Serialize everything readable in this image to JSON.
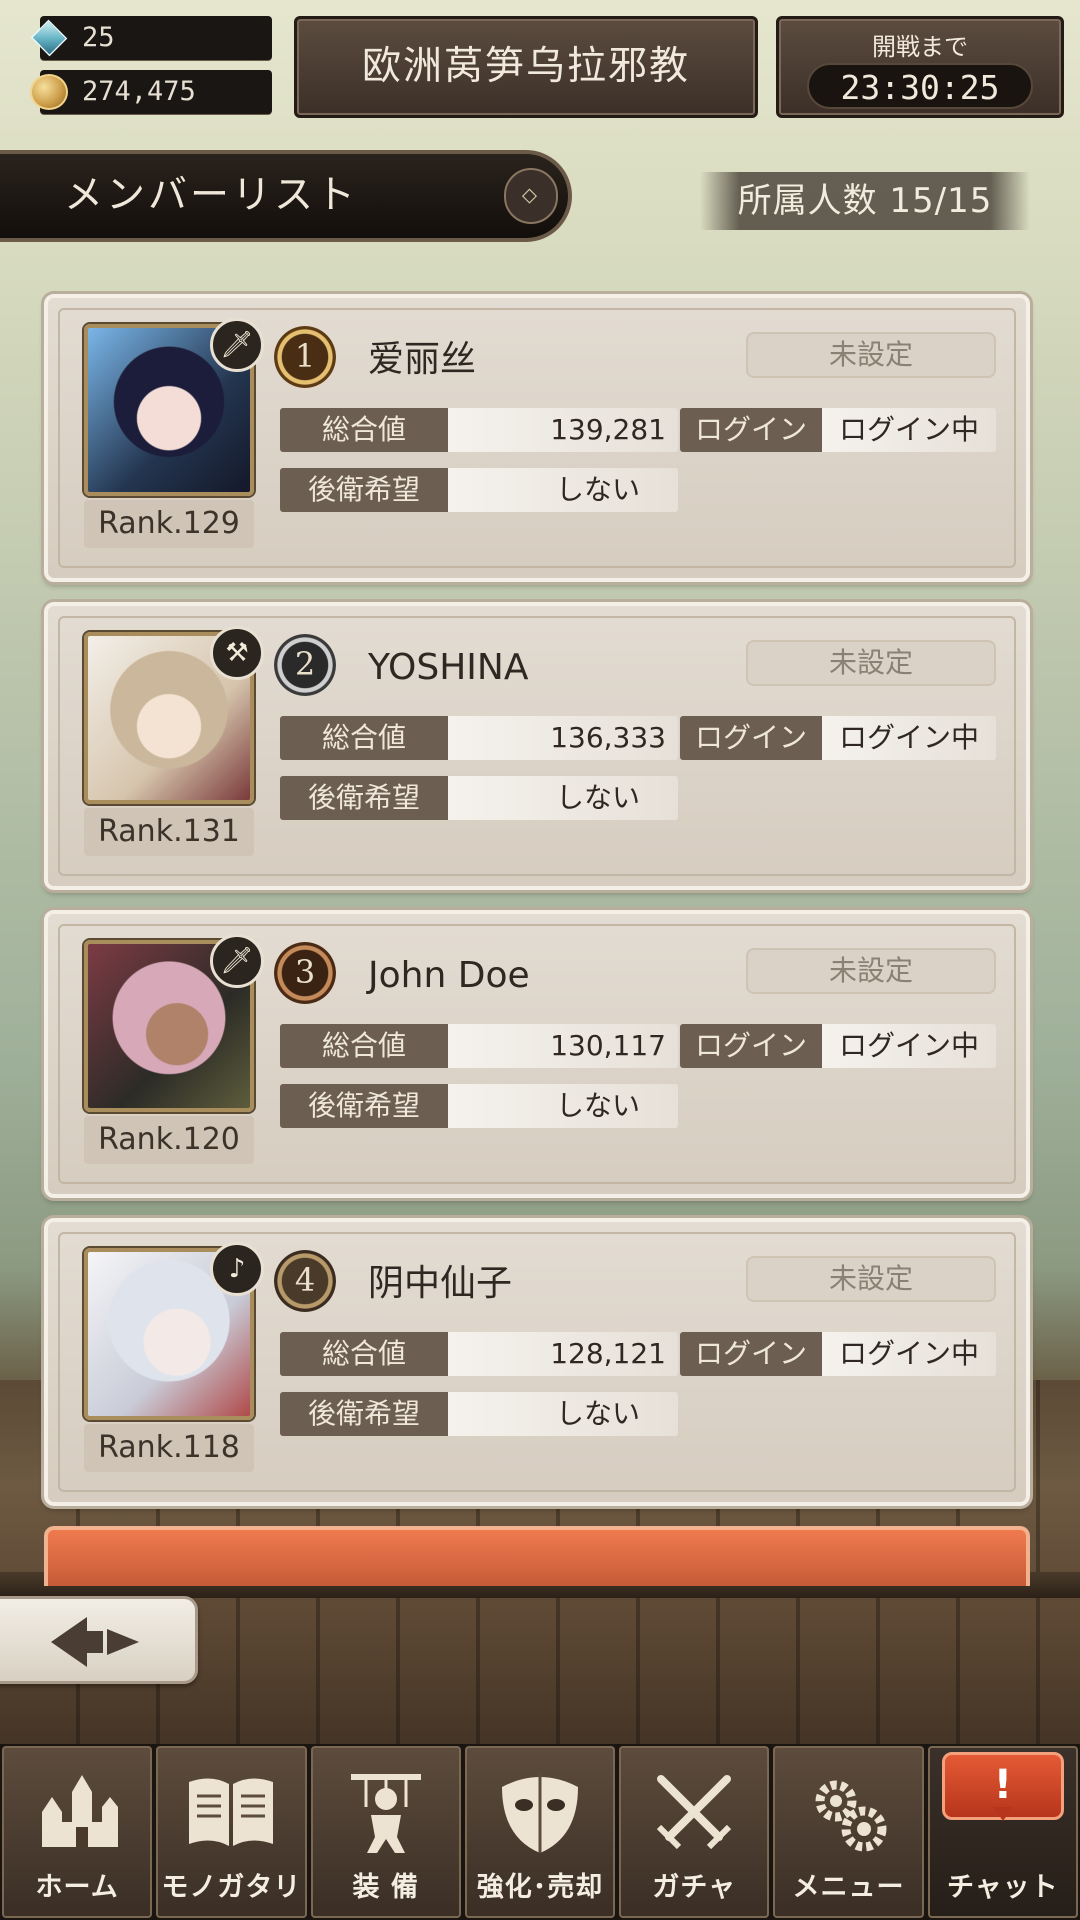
{
  "header": {
    "gems": "25",
    "gold": "274,475",
    "guild_name": "欧洲莴笋乌拉邪教",
    "timer_label": "開戦まで",
    "timer_value": "23:30:25"
  },
  "list": {
    "title": "メンバーリスト",
    "member_count": "所属人数 15/15"
  },
  "labels": {
    "total": "総合値",
    "login": "ログイン",
    "rear": "後衛希望"
  },
  "members": [
    {
      "rank_pos": "1",
      "name": "爱丽丝",
      "status": "未設定",
      "total": "139,281",
      "login": "ログイン中",
      "rear": "しない",
      "rank": "Rank.129",
      "weapon": "sword-icon"
    },
    {
      "rank_pos": "2",
      "name": "YOSHINA",
      "status": "未設定",
      "total": "136,333",
      "login": "ログイン中",
      "rear": "しない",
      "rank": "Rank.131",
      "weapon": "hammer-icon"
    },
    {
      "rank_pos": "3",
      "name": "John Doe",
      "status": "未設定",
      "total": "130,117",
      "login": "ログイン中",
      "rear": "しない",
      "rank": "Rank.120",
      "weapon": "sword-icon"
    },
    {
      "rank_pos": "4",
      "name": "阴中仙子",
      "status": "未設定",
      "total": "128,121",
      "login": "ログイン中",
      "rear": "しない",
      "rank": "Rank.118",
      "weapon": "harp-icon"
    }
  ],
  "nav": {
    "home": "ホーム",
    "story": "モノガタリ",
    "equip": "装 備",
    "enhance": "強化･売却",
    "gacha": "ガチャ",
    "menu": "メニュー",
    "chat": "チャット",
    "chat_badge": "!"
  },
  "colors": {
    "accent_chat": "#d84a28",
    "panel_dark": "#3b2f27",
    "card_bg": "#ddd5ca"
  }
}
